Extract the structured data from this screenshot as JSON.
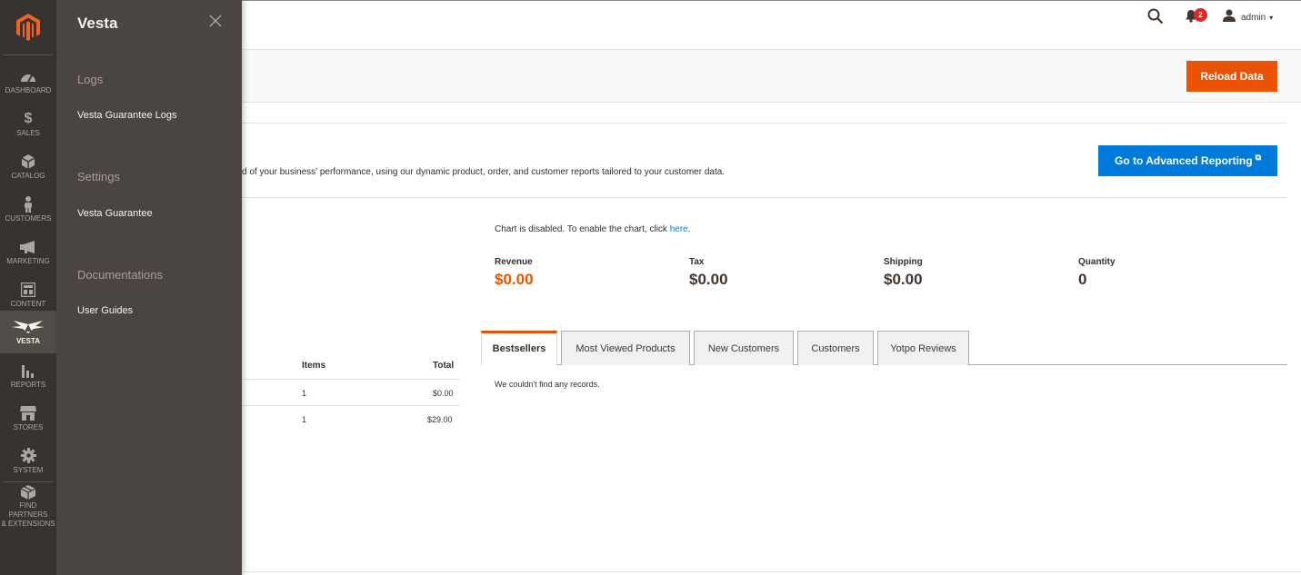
{
  "menu": {
    "items": [
      {
        "label": "DASHBOARD",
        "icon": "dashboard-icon"
      },
      {
        "label": "SALES",
        "icon": "dollar-icon"
      },
      {
        "label": "CATALOG",
        "icon": "box-icon"
      },
      {
        "label": "CUSTOMERS",
        "icon": "person-icon"
      },
      {
        "label": "MARKETING",
        "icon": "megaphone-icon"
      },
      {
        "label": "CONTENT",
        "icon": "layout-icon"
      },
      {
        "label": "VESTA",
        "icon": "vesta-wings-icon"
      },
      {
        "label": "REPORTS",
        "icon": "bar-chart-icon"
      },
      {
        "label": "STORES",
        "icon": "store-icon"
      },
      {
        "label": "SYSTEM",
        "icon": "gear-icon"
      },
      {
        "label": "FIND PARTNERS",
        "label2": "& EXTENSIONS",
        "icon": "cubes-icon"
      }
    ]
  },
  "flyout": {
    "title": "Vesta",
    "sections": [
      {
        "title": "Logs",
        "links": [
          "Vesta Guarantee Logs"
        ]
      },
      {
        "title": "Settings",
        "links": [
          "Vesta Guarantee"
        ]
      },
      {
        "title": "Documentations",
        "links": [
          "User Guides"
        ]
      }
    ]
  },
  "header": {
    "notifications_count": "2",
    "user_name": "admin",
    "caret": "▾"
  },
  "actions": {
    "reload_label": "Reload Data"
  },
  "advanced": {
    "description": "d of your business' performance, using our dynamic product, order, and customer reports tailored to your customer data.",
    "button_label": "Go to Advanced Reporting",
    "external_glyph": "⧉"
  },
  "chart": {
    "note_prefix": "Chart is disabled. To enable the chart, click ",
    "note_link": "here",
    "note_suffix": "."
  },
  "totals": [
    {
      "label": "Revenue",
      "value": "$0.00"
    },
    {
      "label": "Tax",
      "value": "$0.00"
    },
    {
      "label": "Shipping",
      "value": "$0.00"
    },
    {
      "label": "Quantity",
      "value": "0"
    }
  ],
  "orders_grid": {
    "headers": {
      "items": "Items",
      "total": "Total"
    },
    "rows": [
      {
        "items": "1",
        "total": "$0.00"
      },
      {
        "items": "1",
        "total": "$29.00"
      }
    ]
  },
  "tabs": {
    "items": [
      "Bestsellers",
      "Most Viewed Products",
      "New Customers",
      "Customers",
      "Yotpo Reviews"
    ],
    "active": "Bestsellers",
    "empty_message": "We couldn't find any records."
  },
  "colors": {
    "menu_bg": "#373330",
    "flyout_bg": "#4a4542",
    "accent_orange": "#eb5202",
    "accent_blue": "#007bdb",
    "badge_red": "#e22626"
  }
}
